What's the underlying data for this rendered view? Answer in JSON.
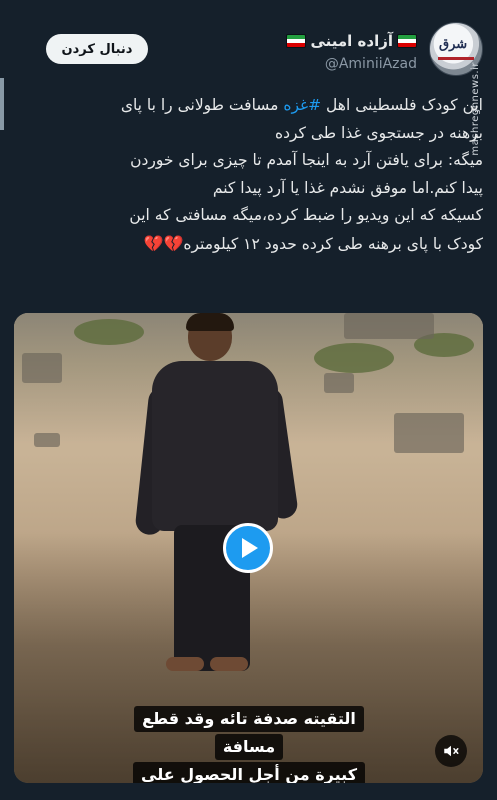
{
  "header": {
    "display_name": "آزاده امینی",
    "handle": "@AminiiAzad",
    "follow_label": "دنبال کردن",
    "watermark": "mashreghnews.ir",
    "avatar_logo": "شرق"
  },
  "tweet": {
    "line1_prefix": "این کودک فلسطینی اهل ",
    "hashtag": "#غزه",
    "line1_suffix": " مسافت طولانی را با پای",
    "line2": "برهنه در جستجوی غذا طی کرده",
    "line3": "میگه: برای یافتن آرد به اینجا آمدم تا چیزی برای خوردن",
    "line4": "پیدا کنم.اما موفق نشدم غذا یا آرد پیدا کنم",
    "line5": "کسیکه که این ویدیو را ضبط کرده،میگه مسافتی که این",
    "line6": "کودک با پای برهنه طی کرده حدود ۱۲ کیلومتره",
    "hearts": "💔💔"
  },
  "video": {
    "caption_lines": [
      "التقيته صدفة تائه وقد قطع",
      "مسافة",
      "كبيرة من أجل الحصول على"
    ]
  },
  "colors": {
    "background": "#15202b",
    "accent": "#1d9bf0",
    "muted_text": "#8b98a5"
  },
  "icons": {
    "play": "play-icon",
    "mute": "speaker-muted-icon",
    "flag": "iran-flag-icon"
  }
}
